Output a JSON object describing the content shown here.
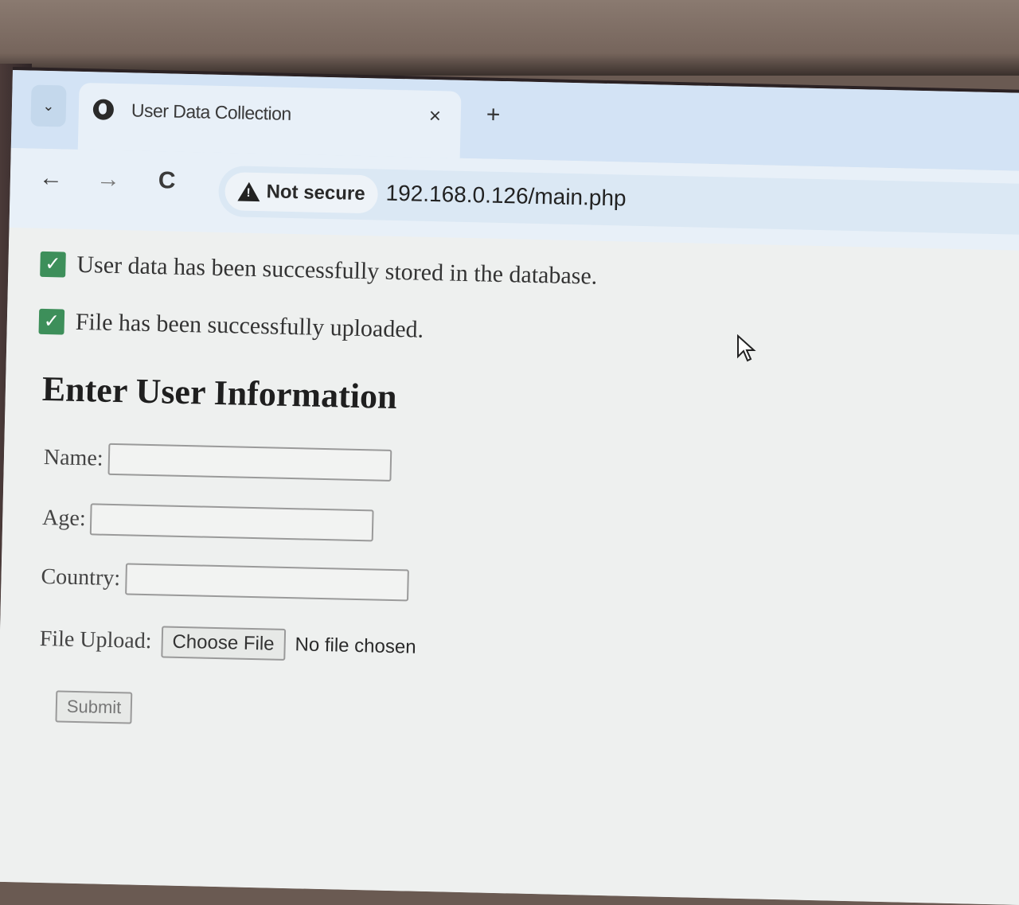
{
  "browser": {
    "tab_title": "User Data Collection",
    "tab_close": "×",
    "new_tab": "+",
    "tab_dropdown": "⌄",
    "back": "←",
    "forward": "→",
    "reload": "C",
    "security_label": "Not secure",
    "url": "192.168.0.126/main.php"
  },
  "messages": [
    {
      "icon": "checkbox-checked-icon",
      "text": "User data has been successfully stored in the database."
    },
    {
      "icon": "checkbox-checked-icon",
      "text": "File has been successfully uploaded."
    }
  ],
  "form": {
    "heading": "Enter User Information",
    "name_label": "Name:",
    "name_value": "",
    "age_label": "Age:",
    "age_value": "",
    "country_label": "Country:",
    "country_value": "",
    "file_label": "File Upload:",
    "file_button": "Choose File",
    "file_status": "No file chosen",
    "submit_label": "Submit"
  },
  "colors": {
    "check_green": "#3d8f5a",
    "tabstrip": "#d3e3f5",
    "toolbar": "#e8f0f8"
  }
}
